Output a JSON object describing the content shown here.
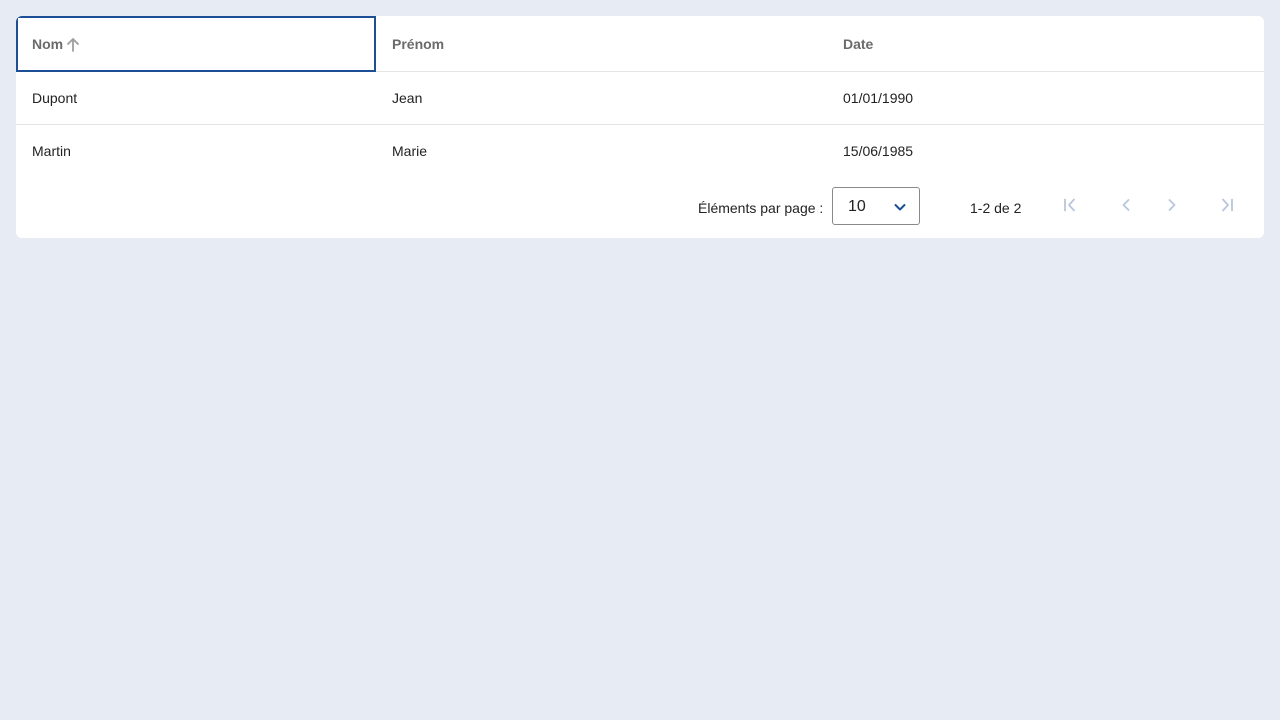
{
  "table": {
    "columns": [
      {
        "label": "Nom",
        "sorted": "ascending",
        "icon": "arrow-up-icon"
      },
      {
        "label": "Prénom"
      },
      {
        "label": "Date"
      }
    ],
    "rows": [
      {
        "nom": "Dupont",
        "prenom": "Jean",
        "date": "01/01/1990"
      },
      {
        "nom": "Martin",
        "prenom": "Marie",
        "date": "15/06/1985"
      }
    ]
  },
  "paginator": {
    "items_per_page_label": "Éléments par page :",
    "page_size": "10",
    "range_label": "1-2 de 2",
    "buttons": {
      "first": "first-page-icon",
      "previous": "chevron-left-icon",
      "next": "chevron-right-icon",
      "last": "last-page-icon"
    }
  },
  "colors": {
    "background": "#e7ebf4",
    "focus_border": "#1c4f96",
    "select_arrow": "#1c4f96",
    "disabled_icon": "#b9c6db"
  }
}
